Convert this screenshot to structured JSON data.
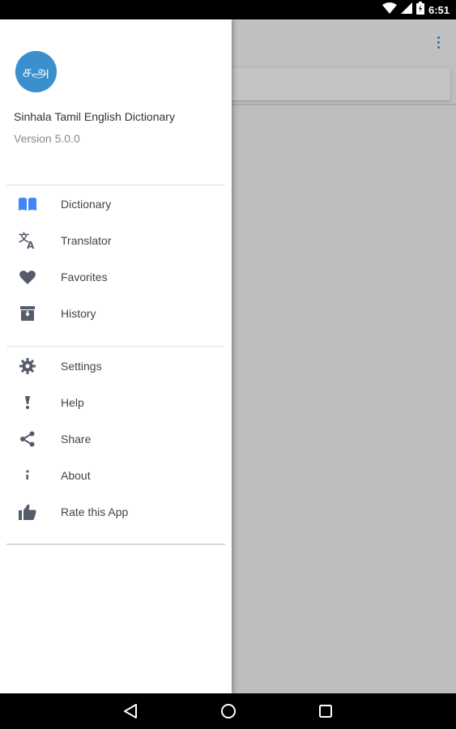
{
  "status_bar": {
    "time": "6:51",
    "icons": [
      "wifi-icon",
      "signal-icon",
      "battery-icon"
    ]
  },
  "drawer": {
    "app_name": "Sinhala Tamil English Dictionary",
    "version": "Version 5.0.0",
    "logo_glyph": "சஅ",
    "logo_color": "#3b8fcd",
    "primary_items": [
      {
        "label": "Dictionary",
        "icon": "book-icon",
        "color": "#4285f4"
      },
      {
        "label": "Translator",
        "icon": "translate-icon",
        "color": "#555b6b"
      },
      {
        "label": "Favorites",
        "icon": "heart-icon",
        "color": "#555b6b"
      },
      {
        "label": "History",
        "icon": "archive-icon",
        "color": "#555b6b"
      }
    ],
    "secondary_items": [
      {
        "label": "Settings",
        "icon": "gear-icon",
        "color": "#555b6b"
      },
      {
        "label": "Help",
        "icon": "exclamation-icon",
        "color": "#555b6b"
      },
      {
        "label": "Share",
        "icon": "share-icon",
        "color": "#555b6b"
      },
      {
        "label": "About",
        "icon": "info-icon",
        "color": "#555b6b"
      },
      {
        "label": "Rate this App",
        "icon": "thumbs-up-icon",
        "color": "#555b6b"
      }
    ]
  },
  "app": {
    "overflow_icon": "overflow-menu-icon",
    "accent": "#4285f4"
  },
  "nav_bar": {
    "buttons": [
      "back-icon",
      "home-icon",
      "recents-icon"
    ]
  }
}
